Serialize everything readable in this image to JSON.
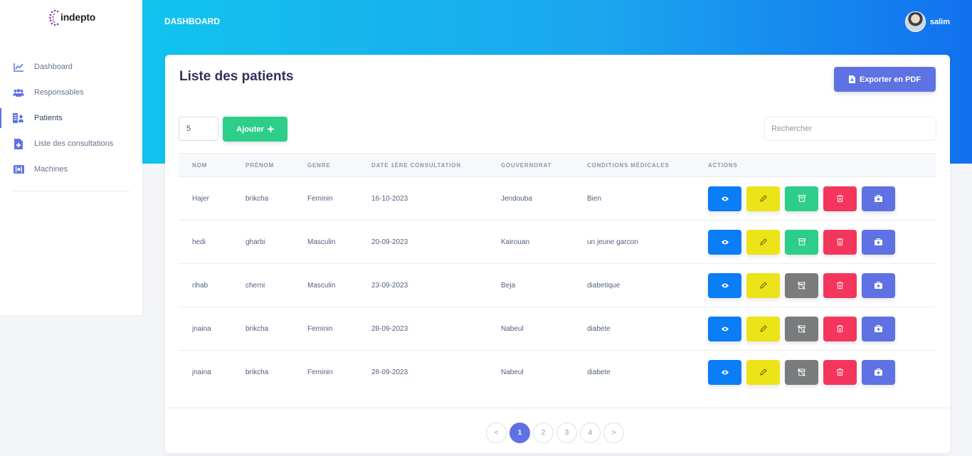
{
  "brand": {
    "name": "indepto",
    "accent": "#5e72e4",
    "gradient_from": "#11c4ee",
    "gradient_to": "#1171ef"
  },
  "header": {
    "title": "DASHBOARD",
    "user_name": "salim"
  },
  "sidebar": {
    "items": [
      {
        "label": "Dashboard",
        "icon": "chart-line-icon"
      },
      {
        "label": "Responsables",
        "icon": "users-icon"
      },
      {
        "label": "Patients",
        "icon": "patient-list-icon",
        "active": true
      },
      {
        "label": "Liste des consultations",
        "icon": "file-medical-icon"
      },
      {
        "label": "Machines",
        "icon": "medical-kit-icon"
      }
    ]
  },
  "main": {
    "title": "Liste des patients",
    "export_label": "Exporter en PDF",
    "per_page_value": "5",
    "add_label": "Ajouter",
    "search_placeholder": "Rechercher",
    "columns": [
      "NOM",
      "PRÉNOM",
      "GENRE",
      "DATE 1ÈRE CONSULTATION",
      "GOUVERNORAT",
      "CONDITIONS MÉDICALES",
      "ACTIONS"
    ],
    "rows": [
      {
        "nom": "Hajer",
        "prenom": "brikcha",
        "genre": "Feminin",
        "date": "16-10-2023",
        "gouvernorat": "Jendouba",
        "conditions": "Bien",
        "archived": false
      },
      {
        "nom": "hedi",
        "prenom": "gharbi",
        "genre": "Masculin",
        "date": "20-09-2023",
        "gouvernorat": "Kairouan",
        "conditions": "un jeune garcon",
        "archived": false
      },
      {
        "nom": "rihab",
        "prenom": "cherni",
        "genre": "Masculin",
        "date": "23-09-2023",
        "gouvernorat": "Beja",
        "conditions": "diabetique",
        "archived": true
      },
      {
        "nom": "jnaina",
        "prenom": "brikcha",
        "genre": "Feminin",
        "date": "28-09-2023",
        "gouvernorat": "Nabeul",
        "conditions": "diabete",
        "archived": true
      },
      {
        "nom": "jnaina",
        "prenom": "brikcha",
        "genre": "Feminin",
        "date": "28-09-2023",
        "gouvernorat": "Nabeul",
        "conditions": "diabete",
        "archived": true
      }
    ],
    "action_icons": [
      "eye-icon",
      "pencil-icon",
      "archive-icon",
      "trash-icon",
      "medical-kit-icon"
    ],
    "pagination": {
      "prev": "<",
      "pages": [
        "1",
        "2",
        "3",
        "4"
      ],
      "current": "1",
      "next": ">"
    }
  }
}
